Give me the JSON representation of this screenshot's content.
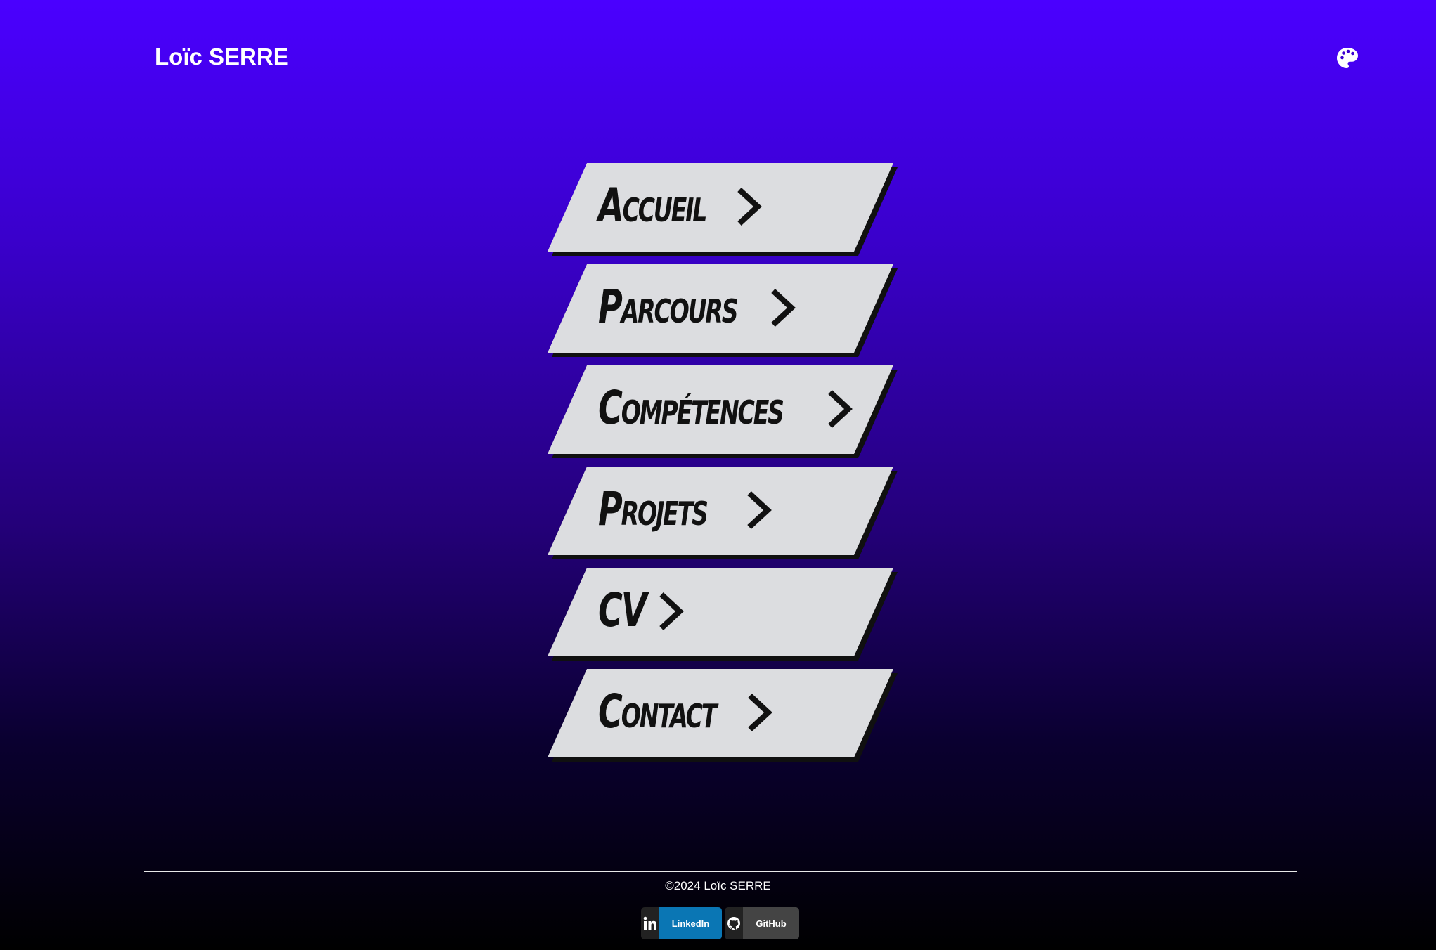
{
  "header": {
    "brand": "Loïc SERRE",
    "theme_icon": "palette-icon"
  },
  "menu": {
    "items": [
      {
        "label": "Accueil",
        "icon": "chevron-right-icon"
      },
      {
        "label": "Parcours",
        "icon": "chevron-right-icon"
      },
      {
        "label": "Compétences",
        "icon": "chevron-right-icon"
      },
      {
        "label": "Projets",
        "icon": "chevron-right-icon"
      },
      {
        "label": "CV",
        "icon": "chevron-right-icon"
      },
      {
        "label": "Contact",
        "icon": "chevron-right-icon"
      }
    ]
  },
  "footer": {
    "copyright": "©2024 Loïc SERRE",
    "links": [
      {
        "label": "LinkedIn",
        "icon": "linkedin-icon",
        "color": "#0a76b4"
      },
      {
        "label": "GitHub",
        "icon": "github-icon",
        "color": "#444444"
      }
    ]
  },
  "colors": {
    "gradient_top": "#4a00ff",
    "gradient_bottom": "#000000",
    "button_face": "#dcdde0",
    "button_text": "#111111"
  }
}
